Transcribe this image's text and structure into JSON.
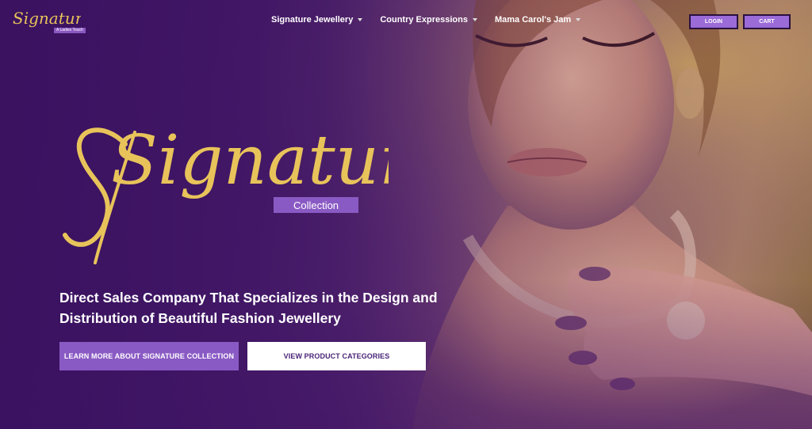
{
  "header": {
    "logo_text": "Signature",
    "logo_tag": "A Ladies Touch",
    "nav": [
      {
        "label": "Signature Jewellery"
      },
      {
        "label": "Country Expressions"
      },
      {
        "label": "Mama Carol's Jam"
      }
    ],
    "login_label": "LOGIN",
    "cart_label": "CART"
  },
  "hero": {
    "logo_text": "Signature",
    "collection_label": "Collection",
    "headline_line1": "Direct Sales Company That Specializes in the Design and",
    "headline_line2": "Distribution of Beautiful Fashion Jewellery",
    "learn_more_label": "LEARN MORE ABOUT SIGNATURE COLLECTION",
    "view_categories_label": "VIEW PRODUCT CATEGORIES"
  },
  "colors": {
    "accent_purple": "#8a5ac4",
    "logo_gold": "#e8c35a",
    "background_purple": "#3b1260"
  }
}
